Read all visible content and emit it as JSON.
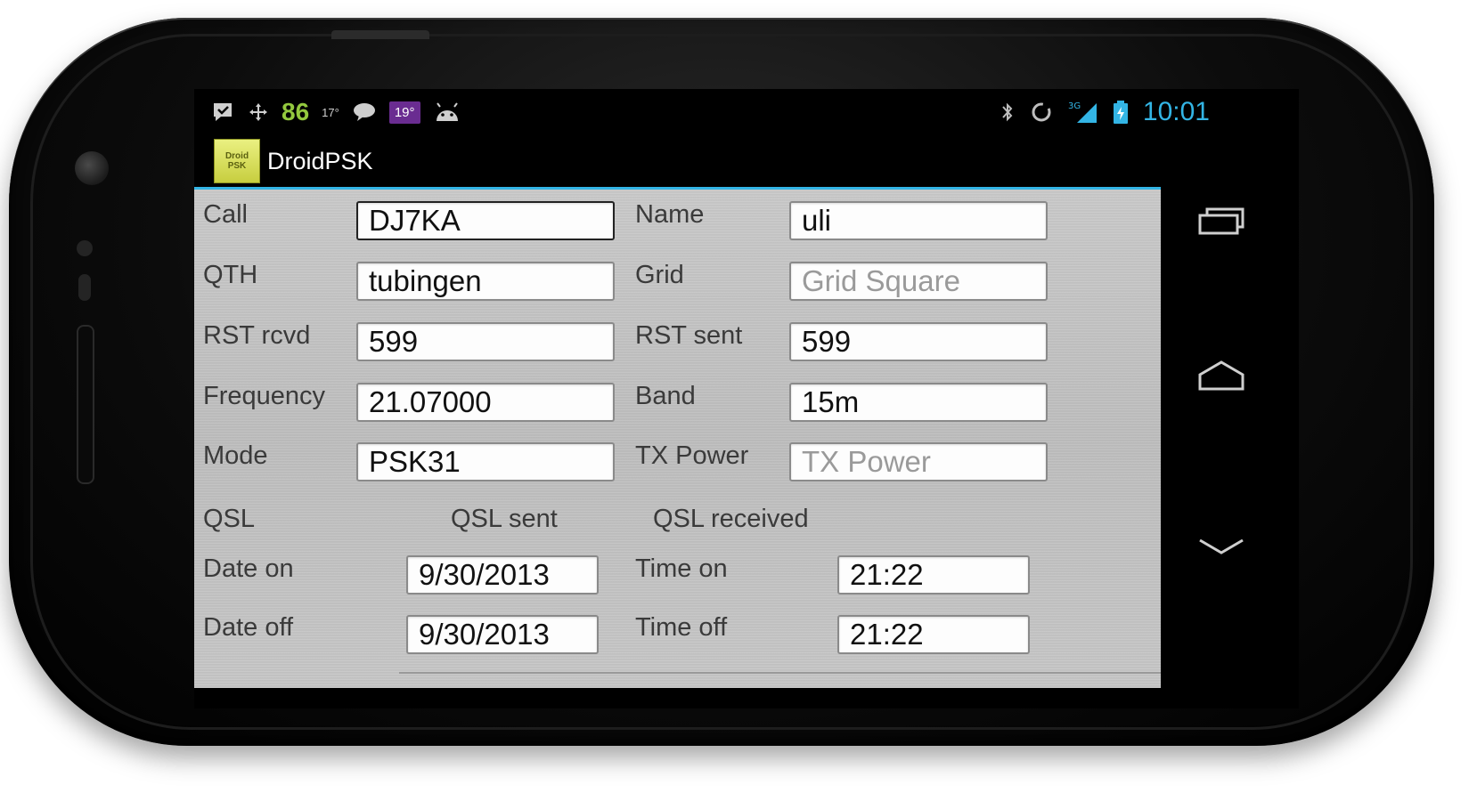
{
  "statusbar": {
    "notification_count": "86",
    "weather_badge": "19°",
    "small_temp": "17°",
    "clock": "10:01",
    "network": "3G"
  },
  "actionbar": {
    "app_logo_line1": "Droid",
    "app_logo_line2": "PSK",
    "title": "DroidPSK"
  },
  "form": {
    "call": {
      "label": "Call",
      "value": "DJ7KA"
    },
    "name": {
      "label": "Name",
      "value": "uli"
    },
    "qth": {
      "label": "QTH",
      "value": "tubingen"
    },
    "grid": {
      "label": "Grid",
      "value": "",
      "placeholder": "Grid Square"
    },
    "rst_rcvd": {
      "label": "RST rcvd",
      "value": "599"
    },
    "rst_sent": {
      "label": "RST sent",
      "value": "599"
    },
    "frequency": {
      "label": "Frequency",
      "value": "21.07000"
    },
    "band": {
      "label": "Band",
      "value": "15m"
    },
    "mode": {
      "label": "Mode",
      "value": "PSK31"
    },
    "tx_power": {
      "label": "TX Power",
      "value": "",
      "placeholder": "TX Power"
    },
    "qsl": {
      "label": "QSL",
      "sent_label": "QSL sent",
      "received_label": "QSL received"
    },
    "date_on": {
      "label": "Date on",
      "value": "9/30/2013"
    },
    "time_on": {
      "label": "Time on",
      "value": "21:22"
    },
    "date_off": {
      "label": "Date off",
      "value": "9/30/2013"
    },
    "time_off": {
      "label": "Time off",
      "value": "21:22"
    }
  },
  "colors": {
    "holo_blue": "#33b5e5",
    "notification_green": "#93c83e",
    "badge_purple": "#6a2c91"
  }
}
